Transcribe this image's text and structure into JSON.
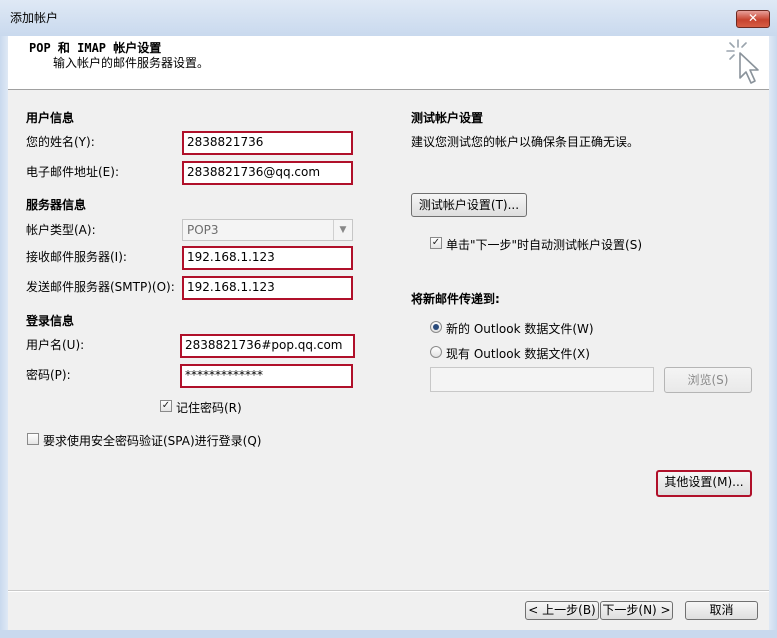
{
  "window": {
    "title": "添加帐户",
    "close_label": "✕"
  },
  "header": {
    "title": "POP 和 IMAP 帐户设置",
    "subtitle": "输入帐户的邮件服务器设置。"
  },
  "user_info": {
    "section": "用户信息",
    "name_label": "您的姓名(Y):",
    "name_value": "2838821736",
    "email_label": "电子邮件地址(E):",
    "email_value": "2838821736@qq.com"
  },
  "server_info": {
    "section": "服务器信息",
    "account_type_label": "帐户类型(A):",
    "account_type_value": "POP3",
    "incoming_label": "接收邮件服务器(I):",
    "incoming_value": "192.168.1.123",
    "outgoing_label": "发送邮件服务器(SMTP)(O):",
    "outgoing_value": "192.168.1.123"
  },
  "login_info": {
    "section": "登录信息",
    "username_label": "用户名(U):",
    "username_value": "2838821736#pop.qq.com",
    "password_label": "密码(P):",
    "password_value": "*************",
    "remember_label": "记住密码(R)",
    "remember_checked": true,
    "spa_label": "要求使用安全密码验证(SPA)进行登录(Q)",
    "spa_checked": false
  },
  "test": {
    "section": "测试帐户设置",
    "desc": "建议您测试您的帐户以确保条目正确无误。",
    "button": "测试帐户设置(T)...",
    "auto_label": "单击\"下一步\"时自动测试帐户设置(S)",
    "auto_checked": true
  },
  "deliver": {
    "section": "将新邮件传递到:",
    "new_label": "新的 Outlook 数据文件(W)",
    "existing_label": "现有 Outlook 数据文件(X)",
    "path_value": "",
    "browse": "浏览(S)"
  },
  "more_settings": "其他设置(M)...",
  "nav": {
    "back": "< 上一步(B)",
    "next": "下一步(N) >",
    "cancel": "取消"
  }
}
